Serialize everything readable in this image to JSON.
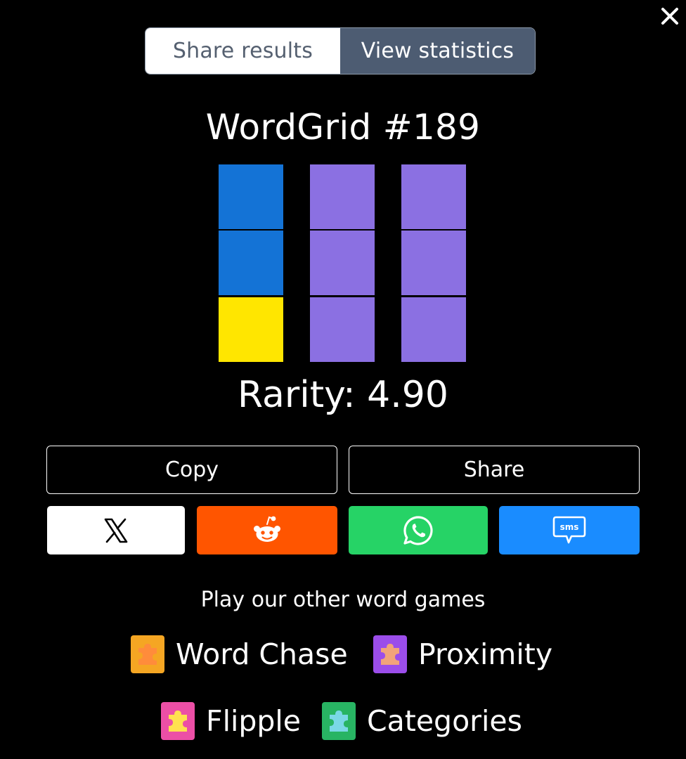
{
  "dialog": {
    "close_icon": "close-icon"
  },
  "tabs": [
    {
      "label": "Share results",
      "active": false
    },
    {
      "label": "View statistics",
      "active": true
    }
  ],
  "result": {
    "title": "WordGrid #189",
    "grid": [
      [
        "blue",
        "purple",
        "purple"
      ],
      [
        "blue",
        "purple",
        "purple"
      ],
      [
        "yellow",
        "purple",
        "purple"
      ]
    ],
    "rarity": "Rarity: 4.90"
  },
  "colors": {
    "blue": "#1473d6",
    "purple": "#8b70e2",
    "yellow": "#ffe600",
    "x_bg": "#ffffff",
    "reddit_bg": "#ff5500",
    "whatsapp_bg": "#26d366",
    "sms_bg": "#1a8cff"
  },
  "actions": {
    "copy_label": "Copy",
    "share_label": "Share"
  },
  "social": [
    {
      "name": "x",
      "icon": "x-logo-icon"
    },
    {
      "name": "reddit",
      "icon": "reddit-icon"
    },
    {
      "name": "whatsapp",
      "icon": "whatsapp-icon"
    },
    {
      "name": "sms",
      "icon": "sms-icon",
      "icon_text": "sms"
    }
  ],
  "promo": {
    "title": "Play our other word games",
    "games": [
      {
        "label": "Word Chase",
        "icon_color": "#f5a623"
      },
      {
        "label": "Proximity",
        "icon_color": "#9b4dea"
      },
      {
        "label": "Flipple",
        "icon_color": "#ec4fa6"
      },
      {
        "label": "Categories",
        "icon_color": "#28b463"
      }
    ]
  }
}
